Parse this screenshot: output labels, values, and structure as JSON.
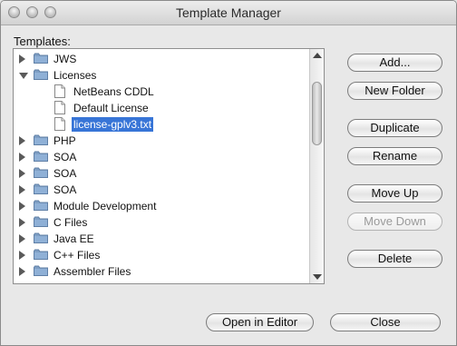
{
  "window": {
    "title": "Template Manager"
  },
  "templates_label": "Templates:",
  "tree": {
    "items": [
      {
        "label": "JWS",
        "type": "folder",
        "state": "collapsed",
        "level": 0
      },
      {
        "label": "Licenses",
        "type": "folder",
        "state": "expanded",
        "level": 0
      },
      {
        "label": "NetBeans CDDL",
        "type": "file",
        "level": 1
      },
      {
        "label": "Default License",
        "type": "file",
        "level": 1
      },
      {
        "label": "license-gplv3.txt",
        "type": "file",
        "level": 1,
        "selected": true
      },
      {
        "label": "PHP",
        "type": "folder",
        "state": "collapsed",
        "level": 0
      },
      {
        "label": "SOA",
        "type": "folder",
        "state": "collapsed",
        "level": 0
      },
      {
        "label": "SOA",
        "type": "folder",
        "state": "collapsed",
        "level": 0
      },
      {
        "label": "SOA",
        "type": "folder",
        "state": "collapsed",
        "level": 0
      },
      {
        "label": "Module Development",
        "type": "folder",
        "state": "collapsed",
        "level": 0
      },
      {
        "label": "C Files",
        "type": "folder",
        "state": "collapsed",
        "level": 0
      },
      {
        "label": "Java EE",
        "type": "folder",
        "state": "collapsed",
        "level": 0
      },
      {
        "label": "C++ Files",
        "type": "folder",
        "state": "collapsed",
        "level": 0
      },
      {
        "label": "Assembler Files",
        "type": "folder",
        "state": "collapsed",
        "level": 0
      }
    ]
  },
  "buttons": {
    "add": "Add...",
    "new_folder": "New Folder",
    "duplicate": "Duplicate",
    "rename": "Rename",
    "move_up": "Move Up",
    "move_down": "Move Down",
    "delete": "Delete",
    "open_in_editor": "Open in Editor",
    "close": "Close"
  },
  "colors": {
    "selection": "#3875d7",
    "folder": "#7f9fc4"
  }
}
